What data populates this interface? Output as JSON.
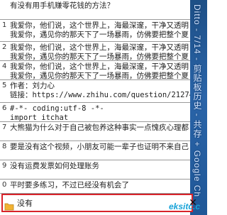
{
  "clipboard_items": [
    {
      "num": "",
      "text": "有没有用手机赚零花钱的方法？"
    },
    {
      "num": "1",
      "text": "我爱你，他们说，这个世界上，海最深邃，干净又透明\n我爱你，遇见你的那天下了一场暴雨，仿佛要把整个夏"
    },
    {
      "num": "2",
      "text": "我爱你，他们说，这个世界上，海最深邃，干净又透明\n我爱你，遇见你的那天下了一场暴雨，仿佛要把整个夏"
    },
    {
      "num": "4",
      "text": "我爱你，他们说，这个世界上，海最深邃，干净又透明\n我爱你，遇见你的那天下了一场暴雨，仿佛要把整个夏"
    },
    {
      "num": "5",
      "text": "作者：刘力心\n链接：https://www.zhihu.com/question/21274188"
    },
    {
      "num": "6",
      "text": "#-*- coding:utf-8 -*-\nimport itchat"
    },
    {
      "num": "7",
      "text": "大熊猫为什么对于自己被包养这种事实一点愧疚心理都"
    },
    {
      "num": "8",
      "text": "要是没有这个视频，小朋友可能一辈子也证明不来自己"
    },
    {
      "num": "9",
      "text": "没有运费发票如何处理账务"
    },
    {
      "num": "0",
      "text": "平时要多练习，不过已经没有机会了"
    }
  ],
  "side_banner_text": "Ditto - 7/14 - 剪贴板历史 - 共存 + Google Ch",
  "search": {
    "value": "没有",
    "clear_label": "✕"
  },
  "watermark": "eksitc.c"
}
